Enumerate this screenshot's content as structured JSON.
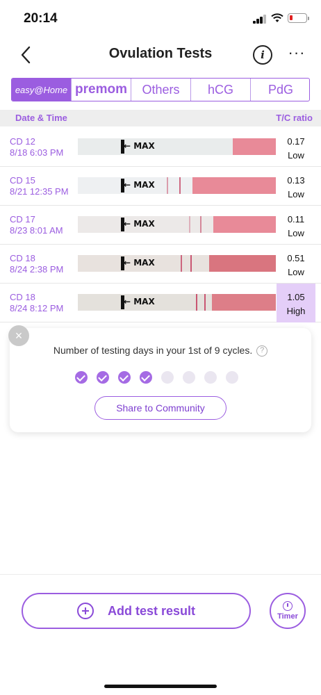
{
  "status_bar": {
    "time": "20:14"
  },
  "header": {
    "title": "Ovulation Tests",
    "info_label": "i",
    "more_label": "···"
  },
  "brand_tabs": [
    {
      "label": "easy@Home",
      "active": true
    },
    {
      "label": "premom",
      "active": false
    },
    {
      "label": "Others",
      "active": false
    },
    {
      "label": "hCG",
      "active": false
    },
    {
      "label": "PdG",
      "active": false
    }
  ],
  "table": {
    "col_left": "Date & Time",
    "col_right": "T/C ratio",
    "rows": [
      {
        "cd": "CD 12",
        "datetime": "8/18 6:03 PM",
        "ratio": "0.17",
        "level": "Low",
        "strip_label": "MAX"
      },
      {
        "cd": "CD 15",
        "datetime": "8/21 12:35 PM",
        "ratio": "0.13",
        "level": "Low",
        "strip_label": "MAX"
      },
      {
        "cd": "CD 17",
        "datetime": "8/23 8:01 AM",
        "ratio": "0.11",
        "level": "Low",
        "strip_label": "MAX"
      },
      {
        "cd": "CD 18",
        "datetime": "8/24 2:38 PM",
        "ratio": "0.51",
        "level": "Low",
        "strip_label": "MAX"
      },
      {
        "cd": "CD 18",
        "datetime": "8/24 8:12 PM",
        "ratio": "1.05",
        "level": "High",
        "strip_label": "MAX"
      }
    ]
  },
  "popup": {
    "close_label": "×",
    "message": "Number of testing days in your 1st of 9 cycles.",
    "help_label": "?",
    "completed_days": 4,
    "total_days": 8,
    "share_label": "Share to Community"
  },
  "bottom": {
    "add_label": "Add test result",
    "timer_label": "Timer"
  },
  "colors": {
    "accent": "#9b5de0",
    "high_bg": "#e4cef8",
    "strip_pink": "#e88a98"
  }
}
